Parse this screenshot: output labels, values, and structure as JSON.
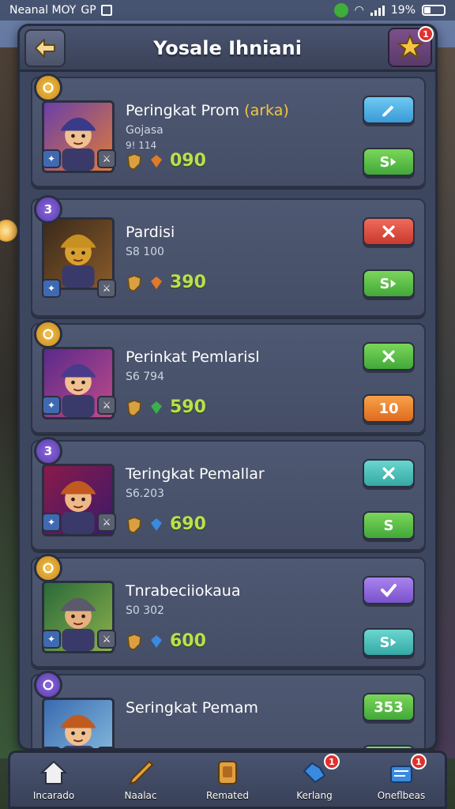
{
  "status_bar": {
    "carrier": "Neanal MOY",
    "carrier_suffix": "GP",
    "battery": "19%"
  },
  "header": {
    "title": "Yosale Ihniani",
    "star_badge": "1"
  },
  "cards": [
    {
      "rank": "",
      "rank_style": "gold",
      "title": "Peringkat Prom ",
      "title_highlight": "(arka)",
      "sub1": "Gojasa",
      "sub2": "9! 114",
      "stat_value": "090",
      "btn_top": "",
      "btn_top_color": "blue",
      "btn_top_icon": "pencil-icon",
      "btn_bottom": "S",
      "btn_bottom_color": "green",
      "btn_bottom_icon": "arrow-icon"
    },
    {
      "rank": "3",
      "rank_style": "purple",
      "title": "Pardisi",
      "title_highlight": "",
      "sub1": "S8 100",
      "sub2": "",
      "stat_value": "390",
      "btn_top": "",
      "btn_top_color": "red",
      "btn_top_icon": "cross-icon",
      "btn_bottom": "S",
      "btn_bottom_color": "green",
      "btn_bottom_icon": "arrow-icon"
    },
    {
      "rank": "",
      "rank_style": "gold",
      "title": "Perinkat Pemlarisl",
      "title_highlight": "",
      "sub1": "S6 794",
      "sub2": "",
      "stat_value": "590",
      "btn_top": "",
      "btn_top_color": "green",
      "btn_top_icon": "cross-icon",
      "btn_bottom": "10",
      "btn_bottom_color": "orange",
      "btn_bottom_icon": ""
    },
    {
      "rank": "3",
      "rank_style": "purple",
      "title": "Teringkat Pemallar",
      "title_highlight": "",
      "sub1": "S6.203",
      "sub2": "",
      "stat_value": "690",
      "btn_top": "",
      "btn_top_color": "teal",
      "btn_top_icon": "cross-icon",
      "btn_bottom": "S",
      "btn_bottom_color": "green",
      "btn_bottom_icon": ""
    },
    {
      "rank": "",
      "rank_style": "gold",
      "title": "Tnrabeciiokaua",
      "title_highlight": "",
      "sub1": "S0 302",
      "sub2": "",
      "stat_value": "600",
      "btn_top": "",
      "btn_top_color": "purple",
      "btn_top_icon": "check-icon",
      "btn_bottom": "S",
      "btn_bottom_color": "teal",
      "btn_bottom_icon": "arrow-icon"
    },
    {
      "rank": "",
      "rank_style": "purple",
      "title": "Seringkat Pemam",
      "title_highlight": "",
      "sub1": "",
      "sub2": "",
      "stat_value": "",
      "btn_top": "353",
      "btn_top_color": "green",
      "btn_top_icon": "",
      "btn_bottom": "",
      "btn_bottom_color": "green",
      "btn_bottom_icon": ""
    }
  ],
  "nav": [
    {
      "label": "Incarado",
      "icon": "home-icon",
      "badge": ""
    },
    {
      "label": "Naalac",
      "icon": "sword-icon",
      "badge": ""
    },
    {
      "label": "Remated",
      "icon": "shield-icon",
      "badge": ""
    },
    {
      "label": "Kerlang",
      "icon": "chat-icon",
      "badge": "1"
    },
    {
      "label": "Oneflbeas",
      "icon": "mail-icon",
      "badge": "1"
    }
  ]
}
